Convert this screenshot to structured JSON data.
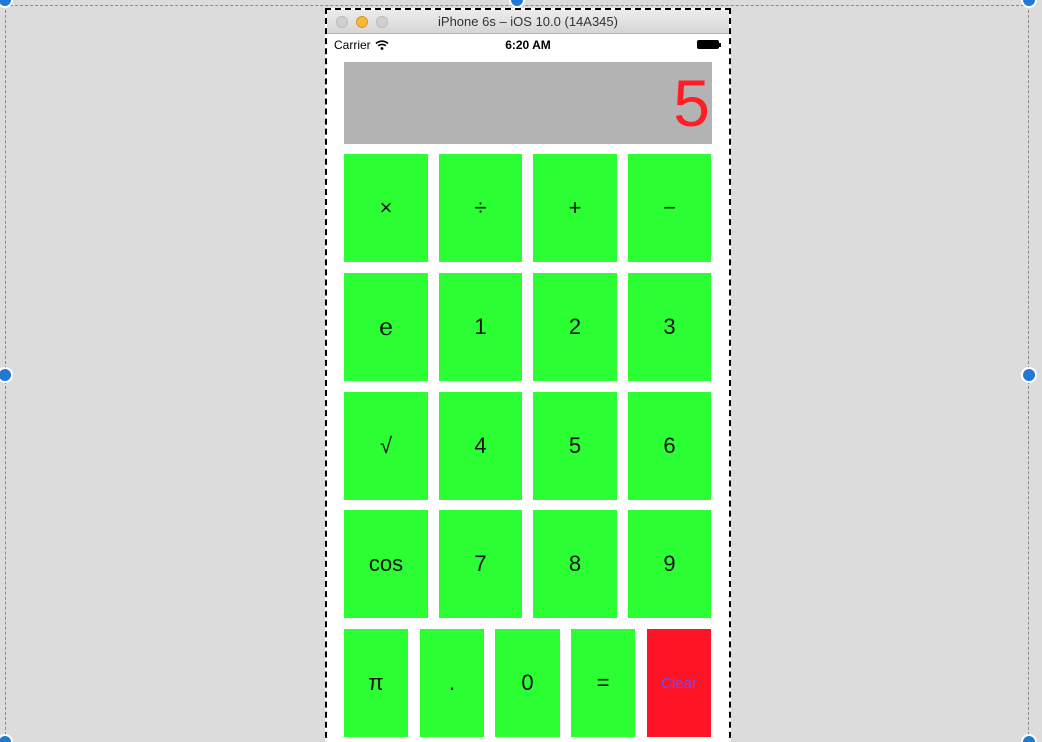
{
  "simulator": {
    "window_title": "iPhone 6s – iOS 10.0 (14A345)"
  },
  "status_bar": {
    "carrier": "Carrier",
    "time": "6:20 AM"
  },
  "display": {
    "value": "5",
    "text_color": "#ff1e26",
    "background": "#b3b3b3"
  },
  "keypad": {
    "button_color": "#2bff33",
    "clear_color": "#ff1425",
    "rows": [
      [
        "×",
        "÷",
        "+",
        "−"
      ],
      [
        "e",
        "1",
        "2",
        "3"
      ],
      [
        "√",
        "4",
        "5",
        "6"
      ],
      [
        "cos",
        "7",
        "8",
        "9"
      ],
      [
        "π",
        ".",
        "0",
        "=",
        "Clear"
      ]
    ]
  }
}
